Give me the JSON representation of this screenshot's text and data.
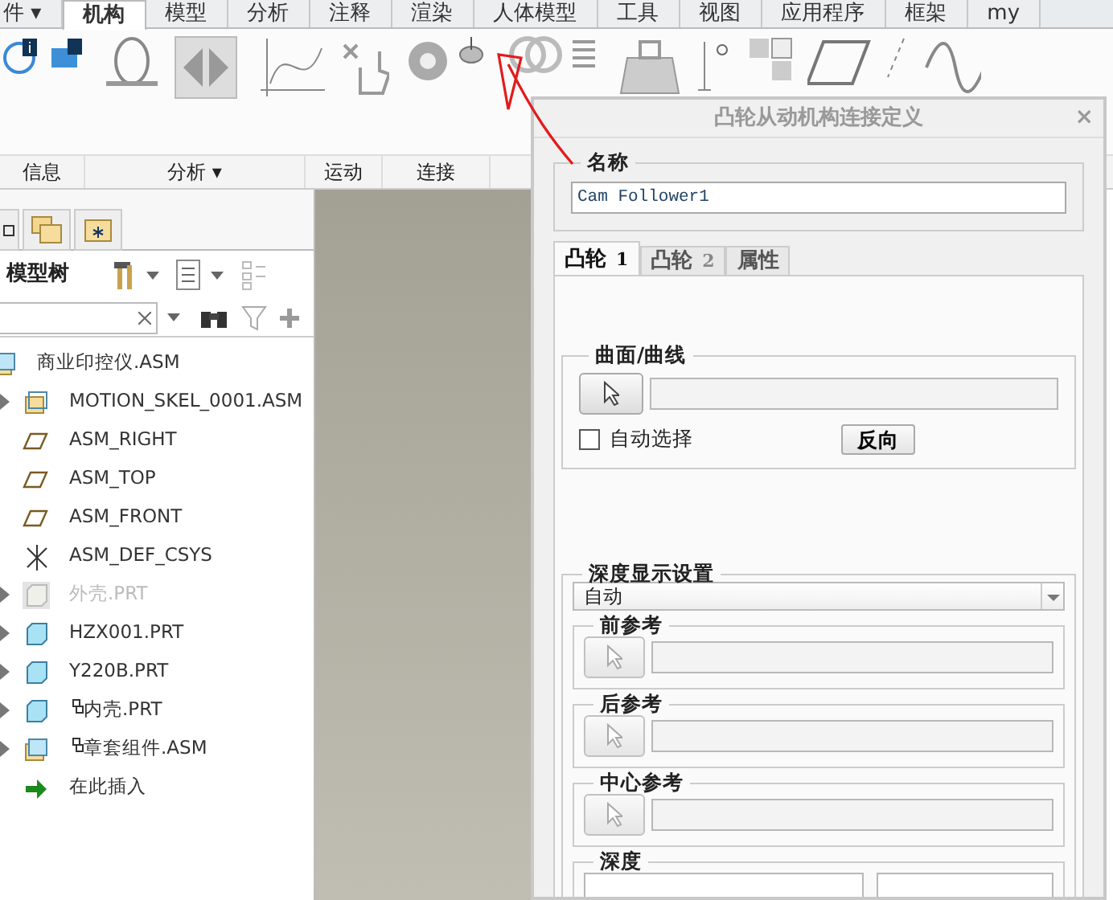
{
  "menu_tabs": [
    {
      "label": "件 ▾",
      "selected": false
    },
    {
      "label": "机构",
      "selected": true
    },
    {
      "label": "模型",
      "selected": false
    },
    {
      "label": "分析",
      "selected": false
    },
    {
      "label": "注释",
      "selected": false
    },
    {
      "label": "渲染",
      "selected": false
    },
    {
      "label": "人体模型",
      "selected": false
    },
    {
      "label": "工具",
      "selected": false
    },
    {
      "label": "视图",
      "selected": false
    },
    {
      "label": "应用程序",
      "selected": false
    },
    {
      "label": "框架",
      "selected": false
    },
    {
      "label": "my",
      "selected": false
    }
  ],
  "ribbon_groups": [
    {
      "label": "信息"
    },
    {
      "label": "分析 ▾"
    },
    {
      "label": "运动"
    },
    {
      "label": "连接"
    }
  ],
  "model_tree": {
    "title": "模型树",
    "items": [
      {
        "label": "商业印控仪.ASM",
        "kind": "asm",
        "dimmed": false,
        "children": [
          {
            "label": "MOTION_SKEL_0001.ASM",
            "kind": "skel",
            "dimmed": false,
            "expandable": true
          },
          {
            "label": "ASM_RIGHT",
            "kind": "plane",
            "dimmed": false,
            "expandable": false
          },
          {
            "label": "ASM_TOP",
            "kind": "plane",
            "dimmed": false,
            "expandable": false
          },
          {
            "label": "ASM_FRONT",
            "kind": "plane",
            "dimmed": false,
            "expandable": false
          },
          {
            "label": "ASM_DEF_CSYS",
            "kind": "csys",
            "dimmed": false,
            "expandable": false
          },
          {
            "label": "外壳.PRT",
            "kind": "part",
            "dimmed": true,
            "expandable": true
          },
          {
            "label": "HZX001.PRT",
            "kind": "part",
            "dimmed": false,
            "expandable": true
          },
          {
            "label": "Y220B.PRT",
            "kind": "part",
            "dimmed": false,
            "expandable": true
          },
          {
            "label": "内壳.PRT",
            "kind": "part-linked",
            "dimmed": false,
            "expandable": true
          },
          {
            "label": "章套组件.ASM",
            "kind": "asm-linked",
            "dimmed": false,
            "expandable": true
          },
          {
            "label": "在此插入",
            "kind": "insert",
            "dimmed": false,
            "expandable": false
          }
        ]
      }
    ]
  },
  "dialog": {
    "title": "凸轮从动机构连接定义",
    "close": "×",
    "name_label": "名称",
    "name_value": "Cam Follower1",
    "tabs": [
      {
        "label": "凸轮",
        "num": "1",
        "selected": true
      },
      {
        "label": "凸轮",
        "num": "2",
        "selected": false
      },
      {
        "label": "属性",
        "selected": false
      }
    ],
    "surface_group": {
      "title": "曲面/曲线",
      "auto_select": {
        "label": "自动选择",
        "checked": false
      },
      "reverse_button": "反向"
    },
    "depth_group": {
      "title": "深度显示设置",
      "mode": "自动",
      "refs": [
        {
          "title": "前参考"
        },
        {
          "title": "后参考"
        },
        {
          "title": "中心参考"
        }
      ],
      "depth_title": "深度"
    }
  }
}
